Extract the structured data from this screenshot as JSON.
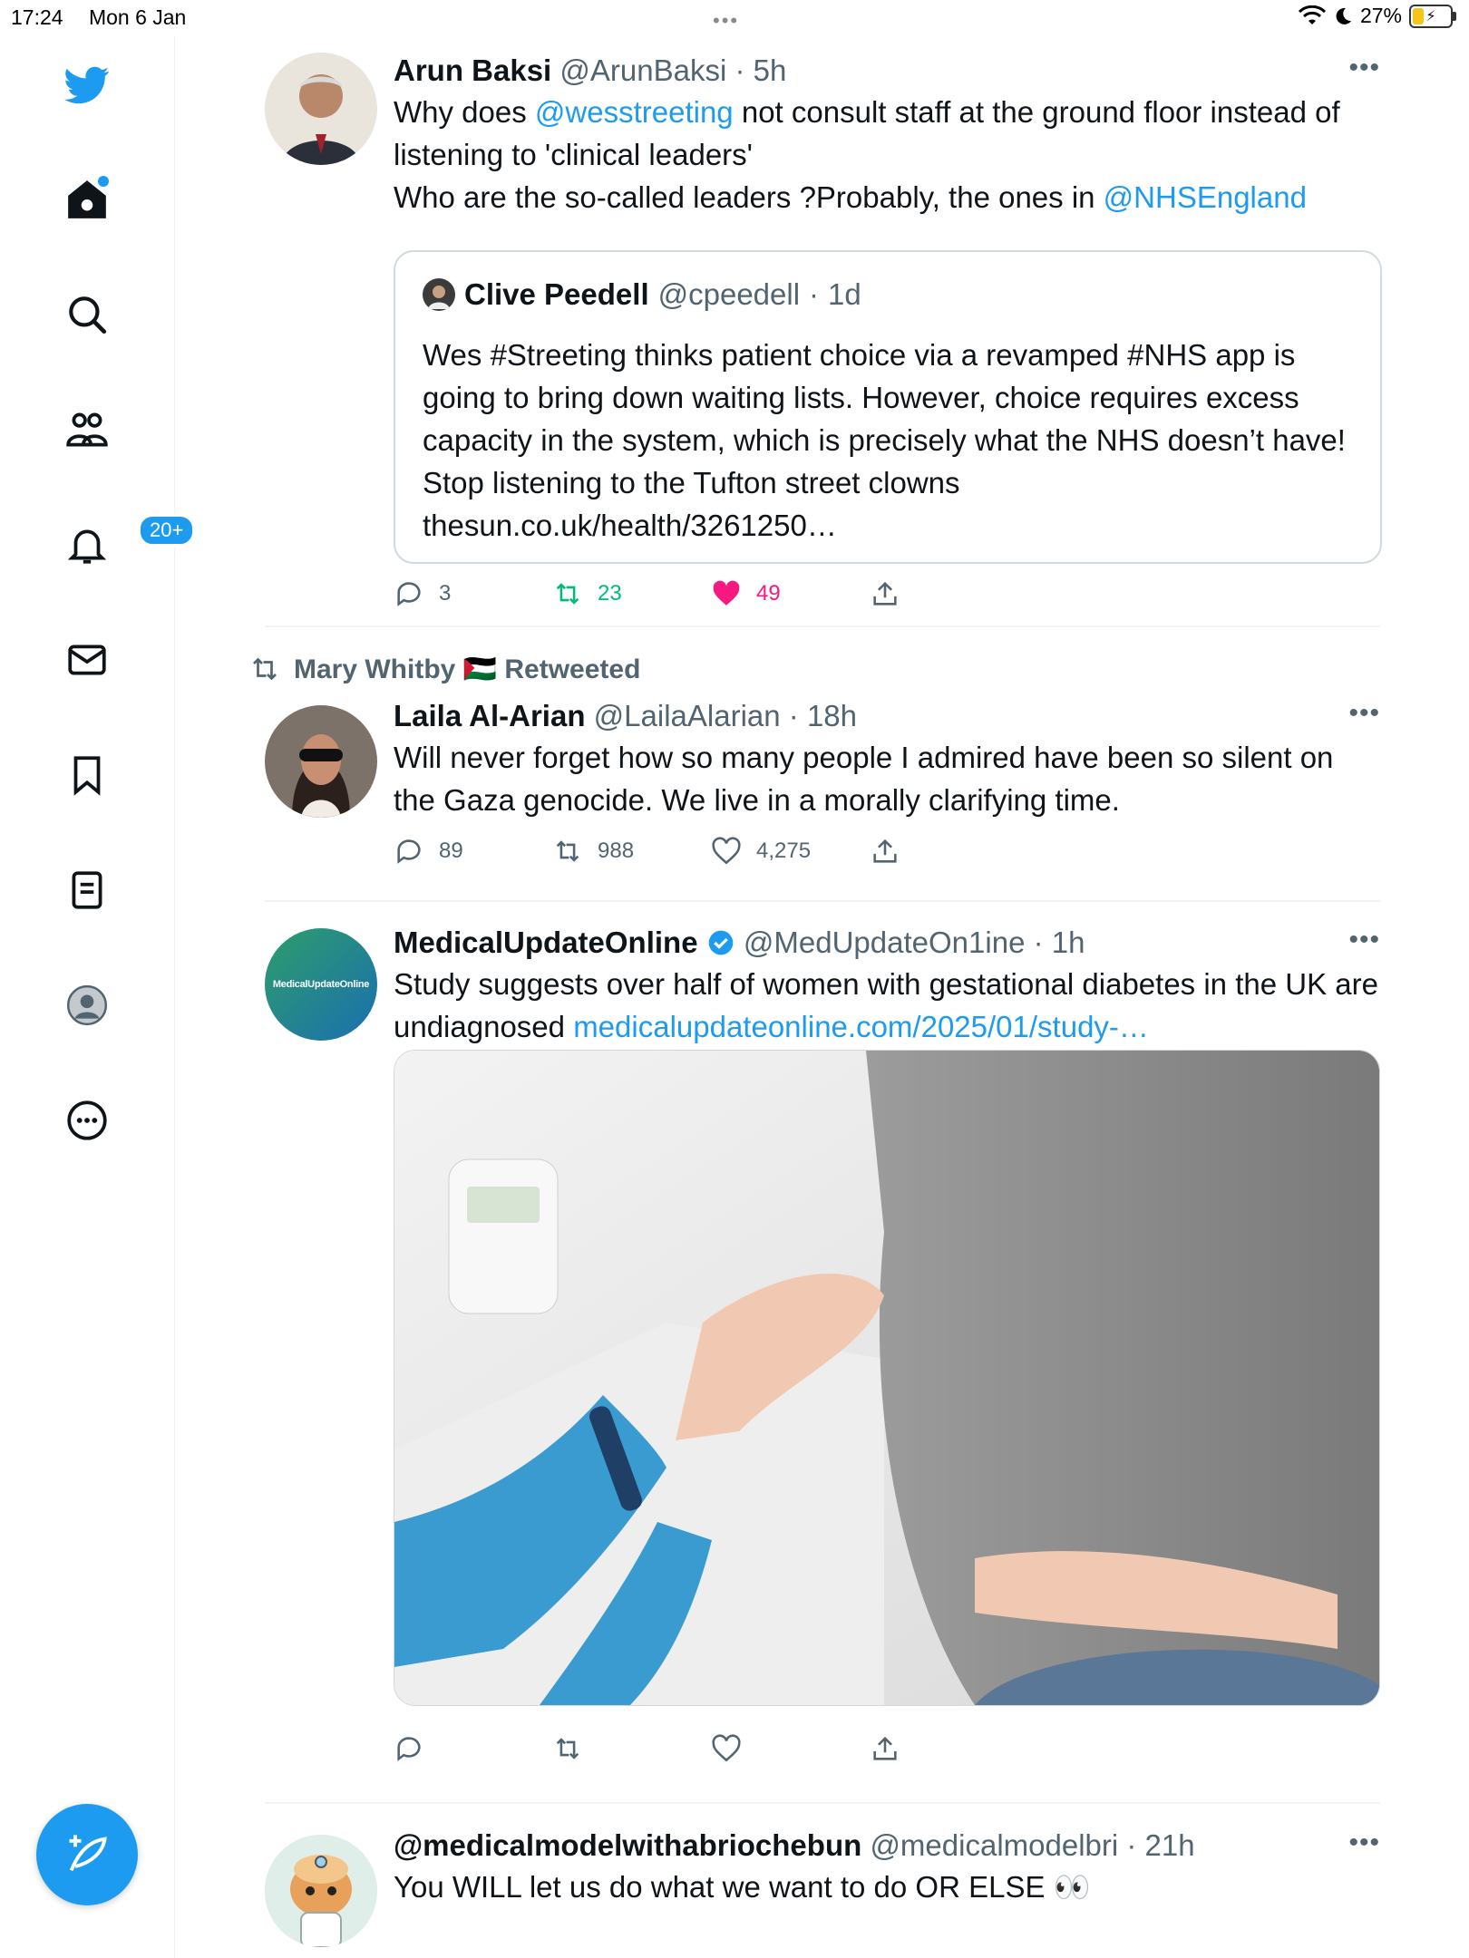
{
  "status_bar": {
    "time": "17:24",
    "date": "Mon 6 Jan",
    "battery": "27%"
  },
  "sidebar": {
    "notifications_badge": "20+"
  },
  "tweets": [
    {
      "name": "Arun Baksi",
      "handle": "@ArunBaksi",
      "time": "5h",
      "text_parts": [
        "Why does ",
        "@wesstreeting",
        " not consult staff at the ground floor instead of listening to 'clinical leaders'",
        "Who are the so-called leaders ?Probably, the ones in ",
        "@NHSEngland"
      ],
      "quote": {
        "name": "Clive Peedell",
        "handle": "@cpeedell",
        "time": "1d",
        "text": "Wes #Streeting thinks patient choice via a revamped #NHS app is going to bring down waiting lists. However, choice requires excess capacity in the system, which is precisely what the NHS doesn’t have! Stop listening to the Tufton street clowns thesun.co.uk/health/3261250…"
      },
      "replies": "3",
      "retweets": "23",
      "likes": "49"
    },
    {
      "retweeted_by": "Mary Whitby 🇵🇸 Retweeted",
      "name": "Laila Al-Arian",
      "handle": "@LailaAlarian",
      "time": "18h",
      "text": "Will never forget how so many people I admired have been so silent on the Gaza genocide. We live in a morally clarifying time.",
      "replies": "89",
      "retweets": "988",
      "likes": "4,275"
    },
    {
      "name": "MedicalUpdateOnline",
      "handle": "@MedUpdateOn1ine",
      "time": "1h",
      "avatar_text": "MedicalUpdateOnline",
      "text_parts": [
        "Study suggests over half of women with gestational diabetes in the UK are undiagnosed ",
        "medicalupdateonline.com/2025/01/study-…"
      ]
    },
    {
      "name": "@medicalmodelwithabriochebun",
      "handle": "@medicalmodelbri",
      "time": "21h",
      "text": "You WILL let us do what we want to do OR ELSE 👀"
    }
  ],
  "colors": {
    "accent": "#1d9bf0",
    "retweet_green": "#00ba7c",
    "like_pink": "#f91880",
    "secondary": "#536471"
  }
}
